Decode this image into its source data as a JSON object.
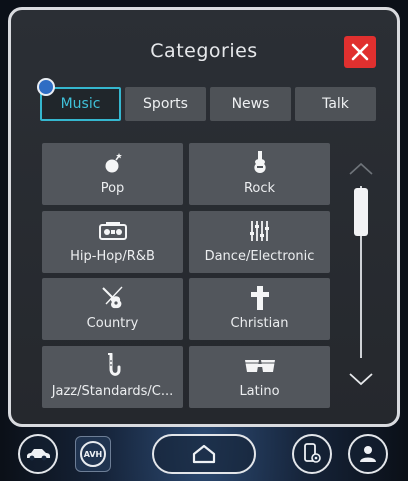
{
  "modal": {
    "title": "Categories",
    "close_color": "#e0302f"
  },
  "tabs": [
    {
      "label": "Music",
      "active": true
    },
    {
      "label": "Sports",
      "active": false
    },
    {
      "label": "News",
      "active": false
    },
    {
      "label": "Talk",
      "active": false
    }
  ],
  "categories": [
    {
      "label": "Pop",
      "icon": "pop-icon"
    },
    {
      "label": "Rock",
      "icon": "electric-guitar-icon"
    },
    {
      "label": "Hip-Hop/R&B",
      "icon": "boombox-icon"
    },
    {
      "label": "Dance/Electronic",
      "icon": "equalizer-sliders-icon"
    },
    {
      "label": "Country",
      "icon": "guitar-icon"
    },
    {
      "label": "Christian",
      "icon": "cross-icon"
    },
    {
      "label": "Jazz/Standards/C...",
      "icon": "saxophone-icon"
    },
    {
      "label": "Latino",
      "icon": "bongo-drums-icon"
    }
  ],
  "bottom_bar": {
    "avh_label": "AVH"
  },
  "colors": {
    "accent": "#35b7cf",
    "tile": "#52565c",
    "tab": "#4e5257"
  }
}
